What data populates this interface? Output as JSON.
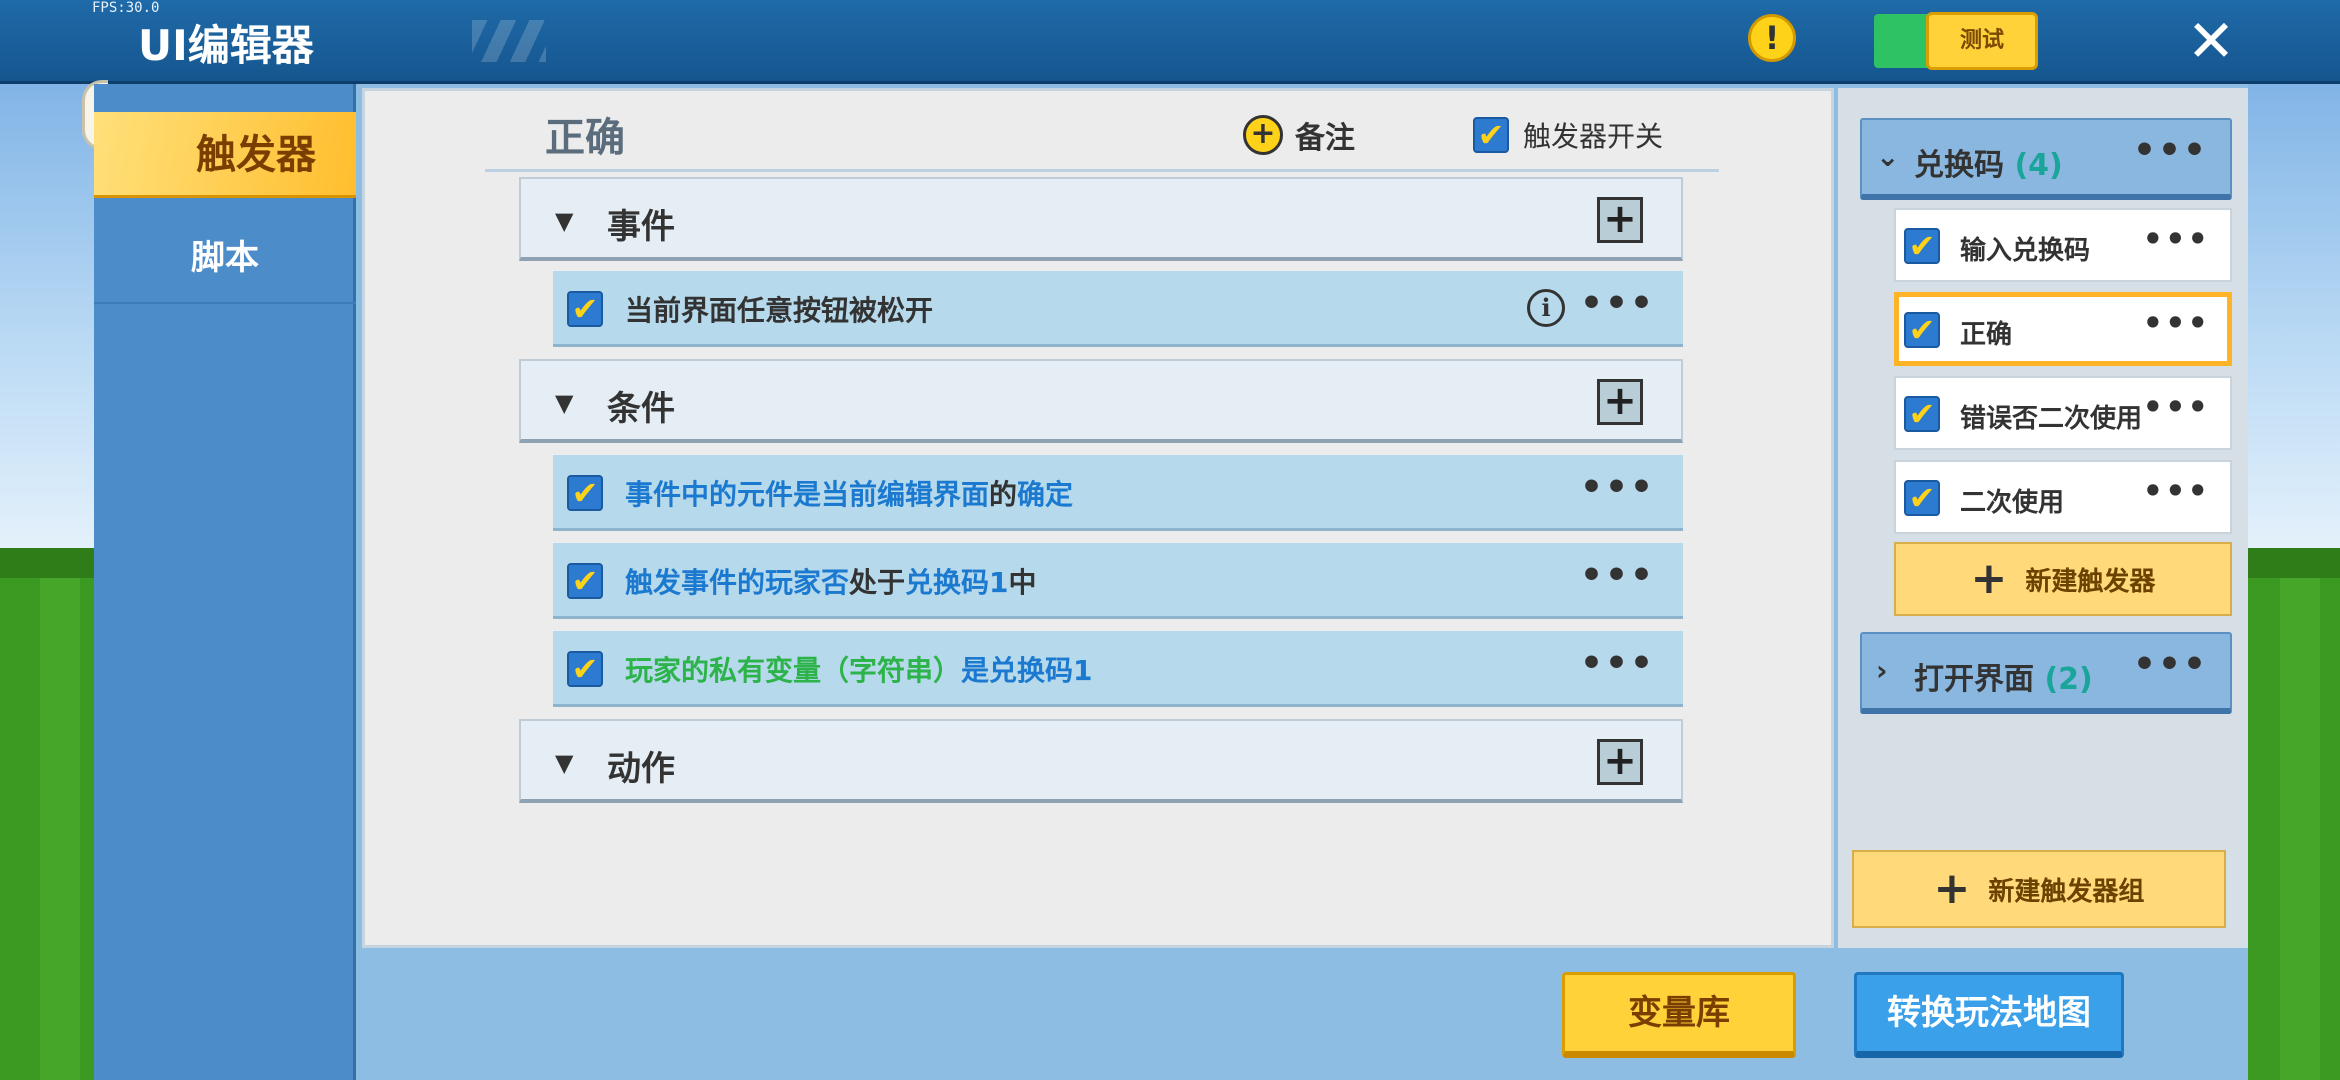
{
  "topbar": {
    "fps": "FPS:30.0",
    "title": "UI编辑器",
    "warning_icon": "!",
    "test_label": "测试",
    "close_icon": "✕"
  },
  "sidebar": {
    "tabs": [
      {
        "label": "触发器",
        "active": true
      },
      {
        "label": "脚本",
        "active": false
      }
    ]
  },
  "editor": {
    "trigger_name": "正确",
    "note_label": "备注",
    "switch_label": "触发器开关",
    "switch_checked": true,
    "sections": {
      "event": {
        "label": "事件",
        "rows": [
          {
            "segments": [
              {
                "text": "当前界面任意按钮被松开",
                "color": "dark"
              }
            ],
            "checked": true,
            "has_info": true
          }
        ]
      },
      "condition": {
        "label": "条件",
        "rows": [
          {
            "segments": [
              {
                "text": "事件中的元件是当前编辑界面",
                "color": "blue"
              },
              {
                "text": "的",
                "color": "dark"
              },
              {
                "text": "确定",
                "color": "blue"
              }
            ],
            "checked": true
          },
          {
            "segments": [
              {
                "text": "触发事件的玩家否",
                "color": "blue"
              },
              {
                "text": "处于",
                "color": "dark"
              },
              {
                "text": "兑换码1",
                "color": "blue"
              },
              {
                "text": "中",
                "color": "dark"
              }
            ],
            "checked": true
          },
          {
            "segments": [
              {
                "text": "玩家的私有变量（字符串）",
                "color": "green"
              },
              {
                "text": "是",
                "color": "blue"
              },
              {
                "text": "兑换码1",
                "color": "blue"
              }
            ],
            "checked": true
          }
        ]
      },
      "action": {
        "label": "动作",
        "rows": []
      }
    }
  },
  "trigger_groups": [
    {
      "name": "兑换码",
      "count": "(4)",
      "expanded": true,
      "items": [
        {
          "label": "输入兑换码",
          "checked": true,
          "selected": false
        },
        {
          "label": "正确",
          "checked": true,
          "selected": true
        },
        {
          "label": "错误否二次使用",
          "checked": true,
          "selected": false
        },
        {
          "label": "二次使用",
          "checked": true,
          "selected": false
        }
      ],
      "new_trigger_label": "新建触发器"
    },
    {
      "name": "打开界面",
      "count": "(2)",
      "expanded": false,
      "items": []
    }
  ],
  "new_group_label": "新建触发器组",
  "bottom": {
    "variable_library": "变量库",
    "convert_map": "转换玩法地图"
  },
  "icons": {
    "more": "•••",
    "plus": "+",
    "check": "✔",
    "info": "i",
    "arrow_down": "▼",
    "chevron_down": "⌄",
    "chevron_right": "›"
  },
  "colors": {
    "accent_yellow": "#ffd23a",
    "brand_blue": "#15568f",
    "text_blue": "#1b7ad0",
    "text_green": "#2cb34a",
    "selection_orange": "#ffb428"
  }
}
